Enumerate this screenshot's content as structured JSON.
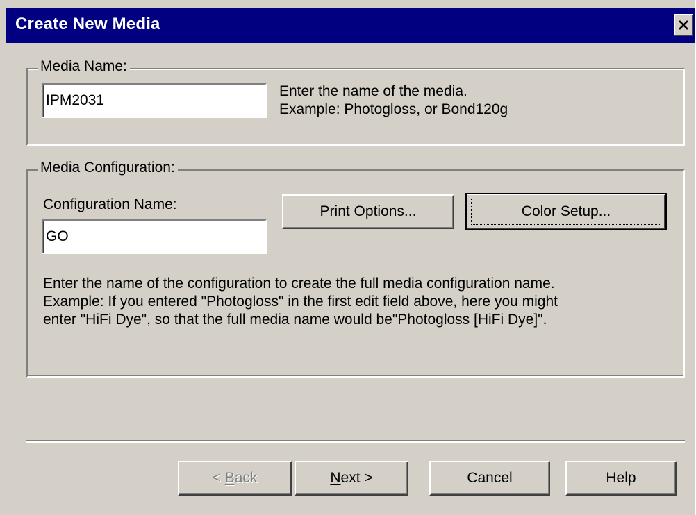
{
  "window": {
    "title": "Create New Media"
  },
  "media_name": {
    "group_label": "Media Name:",
    "value": "IPM2031",
    "hint_line1": "Enter the name of the media.",
    "hint_line2": "Example: Photogloss, or Bond120g"
  },
  "media_configuration": {
    "group_label": "Media Configuration:",
    "config_label": "Configuration Name:",
    "config_value": "GO",
    "print_options_label": "Print Options...",
    "color_setup_label": "Color Setup...",
    "description_line1": "Enter the name of the configuration to create the full media configuration name.",
    "description_line2": "Example: If you entered \"Photogloss\" in the first edit field above, here you might",
    "description_line3": "enter \"HiFi Dye\", so that the full media name would be\"Photogloss [HiFi Dye]\"."
  },
  "buttons": {
    "back_prefix": "< ",
    "back_mnemonic": "B",
    "back_rest": "ack",
    "next_mnemonic": "N",
    "next_rest": "ext >",
    "cancel": "Cancel",
    "help": "Help"
  },
  "icons": {
    "close": "close-icon"
  }
}
